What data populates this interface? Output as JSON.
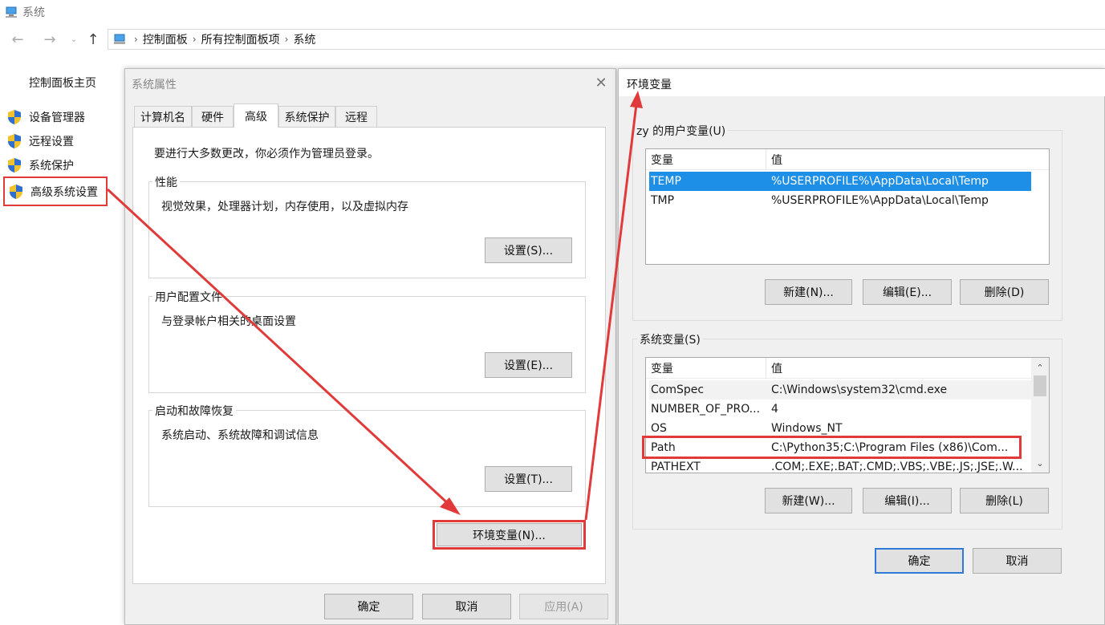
{
  "window": {
    "title": "系统"
  },
  "breadcrumb": [
    "控制面板",
    "所有控制面板项",
    "系统"
  ],
  "sidebar": {
    "home": "控制面板主页",
    "items": [
      "设备管理器",
      "远程设置",
      "系统保护",
      "高级系统设置"
    ]
  },
  "sysprops": {
    "title": "系统属性",
    "tabs": [
      "计算机名",
      "硬件",
      "高级",
      "系统保护",
      "远程"
    ],
    "active_tab": "高级",
    "admin_note": "要进行大多数更改，你必须作为管理员登录。",
    "groups": [
      {
        "label": "性能",
        "desc": "视觉效果，处理器计划，内存使用，以及虚拟内存",
        "button": "设置(S)..."
      },
      {
        "label": "用户配置文件",
        "desc": "与登录帐户相关的桌面设置",
        "button": "设置(E)..."
      },
      {
        "label": "启动和故障恢复",
        "desc": "系统启动、系统故障和调试信息",
        "button": "设置(T)..."
      }
    ],
    "env_button": "环境变量(N)...",
    "ok": "确定",
    "cancel": "取消",
    "apply": "应用(A)"
  },
  "envvars": {
    "title": "环境变量",
    "user_section": "zy 的用户变量(U)",
    "columns": [
      "变量",
      "值"
    ],
    "user_rows": [
      {
        "name": "TEMP",
        "value": "%USERPROFILE%\\AppData\\Local\\Temp"
      },
      {
        "name": "TMP",
        "value": "%USERPROFILE%\\AppData\\Local\\Temp"
      }
    ],
    "user_buttons": [
      "新建(N)...",
      "编辑(E)...",
      "删除(D)"
    ],
    "system_section": "系统变量(S)",
    "system_rows": [
      {
        "name": "ComSpec",
        "value": "C:\\Windows\\system32\\cmd.exe"
      },
      {
        "name": "NUMBER_OF_PRO...",
        "value": "4"
      },
      {
        "name": "OS",
        "value": "Windows_NT"
      },
      {
        "name": "Path",
        "value": "C:\\Python35;C:\\Program Files (x86)\\Com..."
      },
      {
        "name": "PATHEXT",
        "value": ".COM;.EXE;.BAT;.CMD;.VBS;.VBE;.JS;.JSE;.W..."
      }
    ],
    "system_buttons": [
      "新建(W)...",
      "编辑(I)...",
      "删除(L)"
    ],
    "ok": "确定",
    "cancel": "取消"
  },
  "colors": {
    "annotation": "#e03a3a",
    "selection": "#1e8fe6",
    "primary_border": "#2f7ad6"
  },
  "icons": [
    "computer-icon",
    "back-arrow-icon",
    "forward-arrow-icon",
    "chevron-down-icon",
    "up-arrow-icon",
    "shield-icon",
    "close-icon"
  ]
}
